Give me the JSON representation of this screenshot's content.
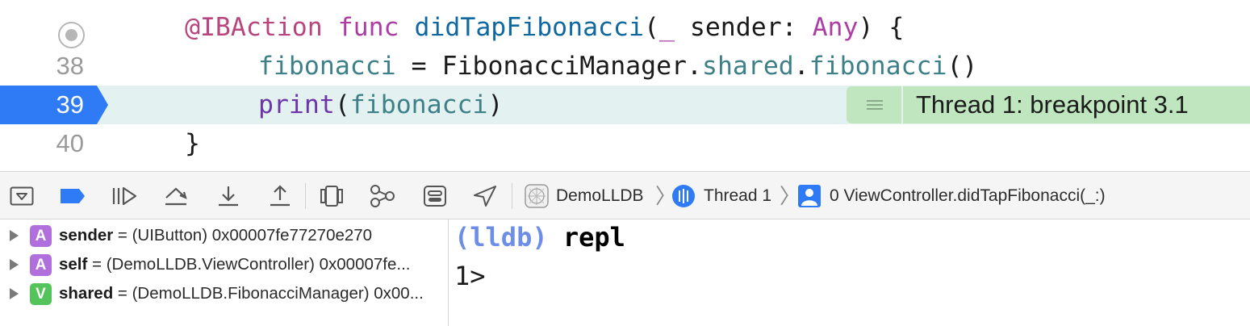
{
  "editor": {
    "line_numbers": {
      "l38": "38",
      "l39": "39",
      "l40": "40"
    },
    "line37": {
      "t1": "@IBAction",
      "t2": " func ",
      "t3": "didTapFibonacci",
      "t4": "(",
      "t5": "_",
      "t6": " sender: ",
      "t7": "Any",
      "t8": ") {"
    },
    "line38": {
      "t1": "fibonacci",
      "t2": " = FibonacciManager.",
      "t3": "shared",
      "t4": ".",
      "t5": "fibonacci",
      "t6": "()"
    },
    "line39": {
      "t1": "print",
      "t2": "(",
      "t3": "fibonacci",
      "t4": ")"
    },
    "line40": {
      "t1": "}"
    },
    "thread_badge": "Thread 1: breakpoint 3.1",
    "colors": {
      "keyword": "#ad3da4",
      "attribute": "#b8457c",
      "breakpoint_marker": "#2f7bf5",
      "current_line_bg": "#e3f1f1",
      "thread_badge_bg": "#bfe6bf"
    }
  },
  "toolbar": {
    "icons": [
      "hide-debug-area-icon",
      "breakpoints-toggle-icon",
      "continue-icon",
      "step-over-icon",
      "step-into-icon",
      "step-out-icon",
      "debug-view-hierarchy-icon",
      "debug-memory-graph-icon",
      "environment-overrides-icon",
      "simulate-location-icon"
    ],
    "breadcrumb": {
      "target": "DemoLLDB",
      "thread": "Thread 1",
      "frame": "0 ViewController.didTapFibonacci(_:)"
    }
  },
  "variables": [
    {
      "kind": "A",
      "name": "sender",
      "value": " = (UIButton) 0x00007fe77270e270"
    },
    {
      "kind": "A",
      "name": "self",
      "value": " = (DemoLLDB.ViewController) 0x00007fe..."
    },
    {
      "kind": "V",
      "name": "shared",
      "value": " = (DemoLLDB.FibonacciManager) 0x00..."
    }
  ],
  "console": {
    "prompt": "(lldb)",
    "command": " repl",
    "repl_prompt": "1>"
  }
}
